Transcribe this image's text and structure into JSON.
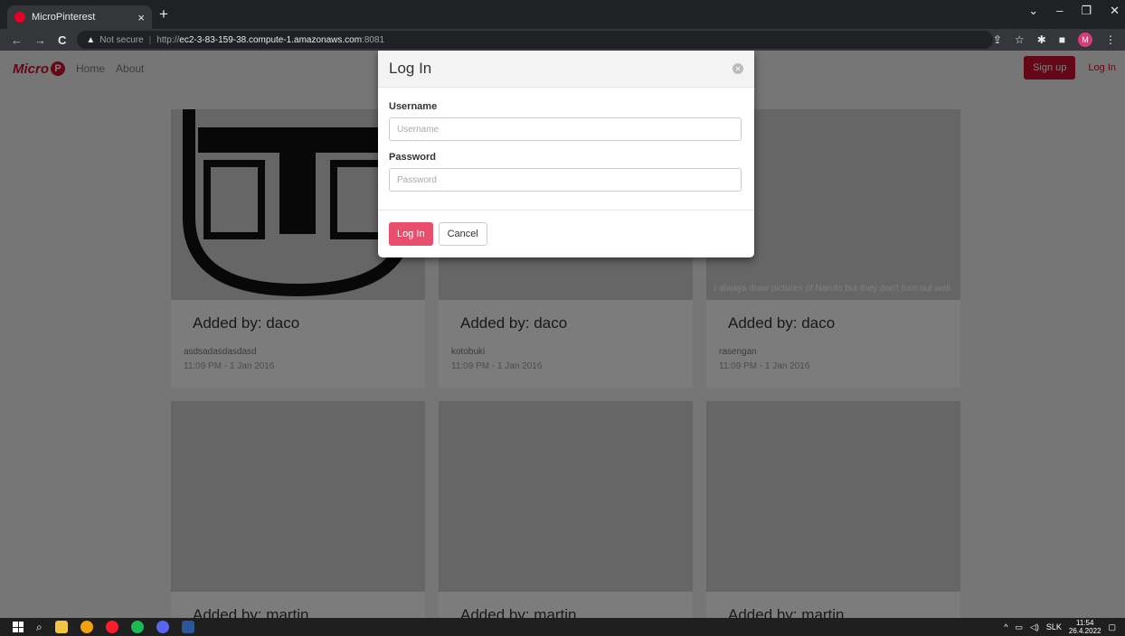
{
  "browser": {
    "tab_title": "MicroPinterest",
    "tab_close": "×",
    "new_tab": "+",
    "window_controls": [
      "⌄",
      "–",
      "❐",
      "✕"
    ],
    "nav": {
      "back": "←",
      "forward": "→",
      "reload": "C"
    },
    "security_label": "Not secure",
    "url_scheme": "http://",
    "url_host": "ec2-3-83-159-38.compute-1.amazonaws.com",
    "url_port": ":8081",
    "profile_initial": "M"
  },
  "site": {
    "brand": "Micro",
    "brand_icon": "pinterest-p",
    "nav_links": [
      "Home",
      "About"
    ],
    "signup_label": "Sign up",
    "login_label": "Log In"
  },
  "cards": [
    {
      "title": "Added by: daco",
      "description": "asdsadasdasdasd",
      "time": "11:09 PM - 1 Jan 2016"
    },
    {
      "title": "Added by: daco",
      "description": "kotobuki",
      "time": "11:09 PM - 1 Jan 2016"
    },
    {
      "title": "Added by: daco",
      "description": "rasengan",
      "time": "11:09 PM - 1 Jan 2016",
      "image_caption": "I always draw pictures of Naruto but they don't turn out well."
    },
    {
      "title": "Added by: martin"
    },
    {
      "title": "Added by: martin"
    },
    {
      "title": "Added by: martin"
    }
  ],
  "modal": {
    "title": "Log In",
    "username_label": "Username",
    "username_placeholder": "Username",
    "username_value": "",
    "password_label": "Password",
    "password_placeholder": "Password",
    "password_value": "",
    "submit_label": "Log In",
    "cancel_label": "Cancel"
  },
  "taskbar": {
    "apps": [
      "file-explorer",
      "chrome",
      "opera",
      "spotify",
      "discord",
      "word"
    ],
    "tray_arrow": "^",
    "language": "SLK",
    "time": "11:54",
    "date": "26.4.2022"
  },
  "colors": {
    "brand_red": "#c8102e",
    "login_button": "#e94e6e"
  }
}
